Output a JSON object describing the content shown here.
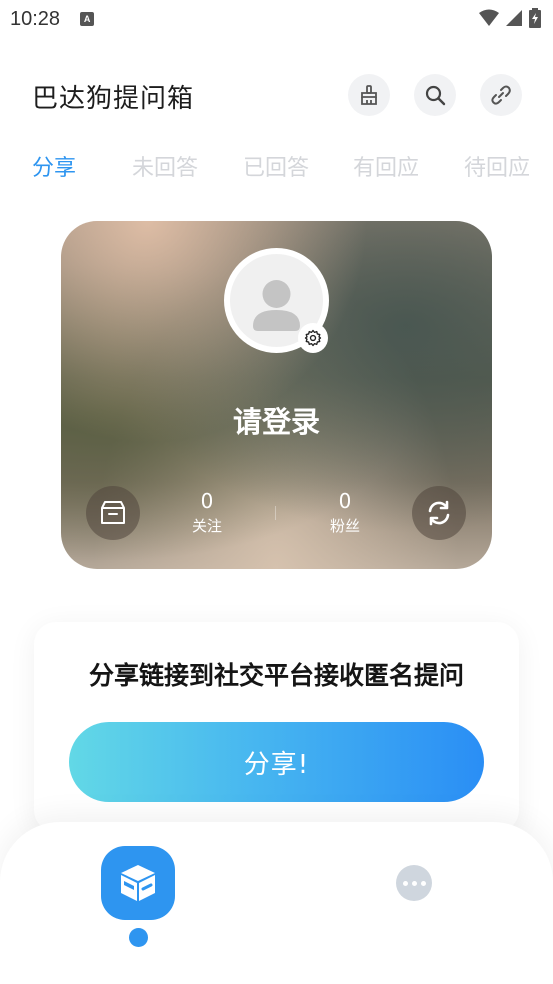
{
  "status_bar": {
    "time": "10:28",
    "indicator": "A"
  },
  "header": {
    "title": "巴达狗提问箱",
    "icons": [
      "broom-icon",
      "search-icon",
      "link-icon"
    ]
  },
  "tabs": [
    {
      "label": "分享",
      "active": true
    },
    {
      "label": "未回答",
      "active": false
    },
    {
      "label": "已回答",
      "active": false
    },
    {
      "label": "有回应",
      "active": false
    },
    {
      "label": "待回应",
      "active": false
    }
  ],
  "profile": {
    "login_prompt": "请登录",
    "following": {
      "value": "0",
      "label": "关注"
    },
    "followers": {
      "value": "0",
      "label": "粉丝"
    }
  },
  "share_card": {
    "title": "分享链接到社交平台接收匿名提问",
    "button_label": "分享!"
  },
  "colors": {
    "accent": "#2e95f0",
    "tab_inactive": "#d4d6da",
    "gradient_start": "#62d8e6",
    "gradient_end": "#2a8ef5"
  }
}
